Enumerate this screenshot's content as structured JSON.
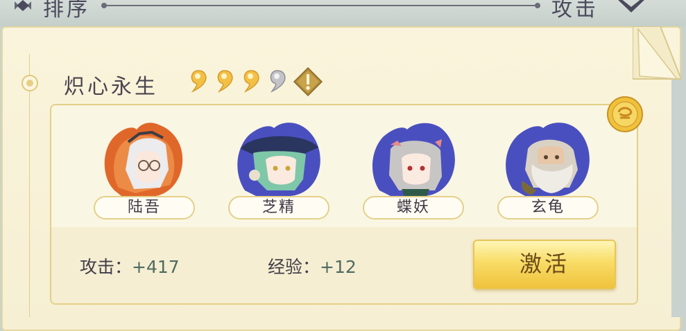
{
  "header": {
    "sort_label": "排序",
    "attack_label": "攻击"
  },
  "set": {
    "title": "炽心永生",
    "magatama": {
      "filled": 3,
      "total": 4
    },
    "icons": [
      "sort-icon",
      "chevron-down-icon",
      "bullet-icon",
      "magatama-icon",
      "warning-icon",
      "coin-icon"
    ]
  },
  "shikigami": [
    {
      "name": "陆吾",
      "aura": "#e0672a"
    },
    {
      "name": "芝精",
      "aura": "#4a4fc0"
    },
    {
      "name": "蝶妖",
      "aura": "#4a4fc0"
    },
    {
      "name": "玄龟",
      "aura": "#4a4fc0"
    }
  ],
  "stats": {
    "attack_label": "攻击：",
    "attack_value": "+417",
    "exp_label": "经验：",
    "exp_value": "+12"
  },
  "activate_label": "激活",
  "colors": {
    "accent_gold": "#f0c23c",
    "panel_bg": "#f8f2d8",
    "text_dark": "#4a4450"
  }
}
